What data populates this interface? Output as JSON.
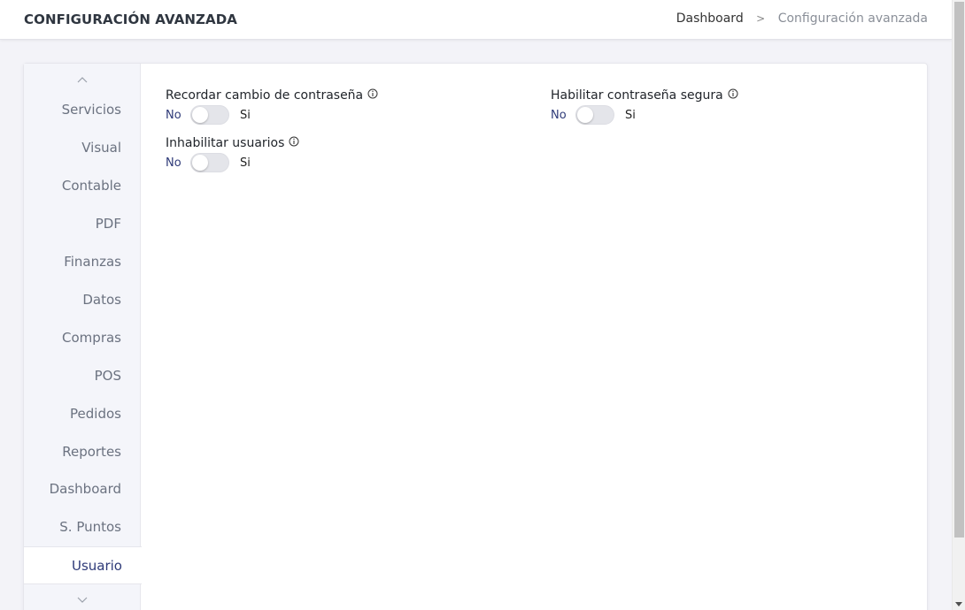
{
  "header": {
    "title": "CONFIGURACIÓN AVANZADA",
    "breadcrumb": {
      "home": "Dashboard",
      "separator": ">",
      "current": "Configuración avanzada"
    }
  },
  "sidebar": {
    "items": [
      {
        "label": "Servicios",
        "active": false
      },
      {
        "label": "Visual",
        "active": false
      },
      {
        "label": "Contable",
        "active": false
      },
      {
        "label": "PDF",
        "active": false
      },
      {
        "label": "Finanzas",
        "active": false
      },
      {
        "label": "Datos",
        "active": false
      },
      {
        "label": "Compras",
        "active": false
      },
      {
        "label": "POS",
        "active": false
      },
      {
        "label": "Pedidos",
        "active": false
      },
      {
        "label": "Reportes",
        "active": false
      },
      {
        "label": "Dashboard",
        "active": false
      },
      {
        "label": "S. Puntos",
        "active": false
      },
      {
        "label": "Usuario",
        "active": true
      }
    ]
  },
  "settings": [
    {
      "label": "Recordar cambio de contraseña",
      "off_label": "No",
      "on_label": "Si",
      "enabled": false
    },
    {
      "label": "Habilitar contraseña segura",
      "off_label": "No",
      "on_label": "Si",
      "enabled": false
    },
    {
      "label": "Inhabilitar usuarios",
      "off_label": "No",
      "on_label": "Si",
      "enabled": false
    }
  ],
  "colors": {
    "accent": "#2e3a78",
    "muted_text": "#6b7280",
    "background": "#f3f3f8"
  }
}
